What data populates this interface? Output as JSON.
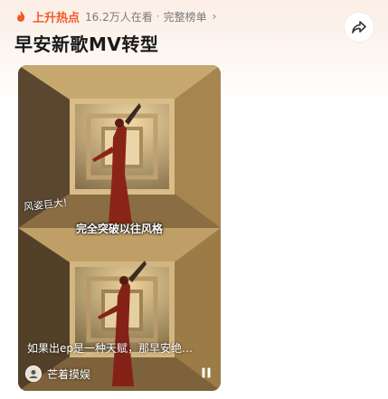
{
  "trend": {
    "label": "上升热点",
    "views": "16.2万人在看",
    "separator": "·",
    "full_list": "完整榜单",
    "chevron": "›",
    "accent_color": "#f25a2a"
  },
  "title": "早安新歌MV转型",
  "share": {
    "icon": "share-icon"
  },
  "video": {
    "caption": "完全突破以往风格",
    "overlay_note": "风姿巨大!",
    "text": "如果出ep是一种天赋，那早安绝…",
    "channel": "芒着摸娱",
    "pause_icon": "pause-icon"
  }
}
